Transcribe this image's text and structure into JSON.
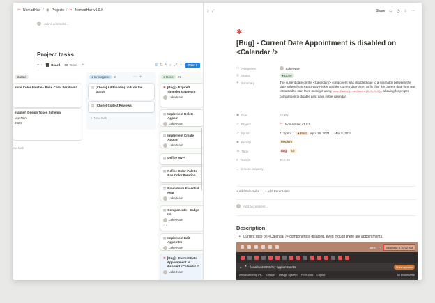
{
  "breadcrumb": {
    "workspace": "NomadHair",
    "projects": "Projects",
    "page": "NomadHair v1.0.0"
  },
  "left": {
    "comment_placeholder": "Add a comment...",
    "title": "Project tasks",
    "views": [
      "Board",
      "Tasks"
    ],
    "new_label": "New"
  },
  "columns": [
    {
      "label": "started",
      "count": "",
      "cards": [
        {
          "title": "efine Color Palette - Base Color Iteration II",
          "user": "",
          "meta": ""
        },
        {
          "title": "stablish Design Token Schema",
          "user": "uke Nam",
          "meta": "2024"
        }
      ],
      "new_task": "ew task"
    },
    {
      "label": "In progress",
      "count": "2",
      "cards": [
        {
          "title": "[Chore] Add loading indi on the button",
          "user": "",
          "meta": ""
        },
        {
          "title": "[Chore] Collect Reviews",
          "user": "",
          "meta": ""
        }
      ],
      "new_task": "New task"
    },
    {
      "label": "Done",
      "count": "21",
      "cards": [
        {
          "title": "[Bug] - Expired Timeslot s appears",
          "user": "Luke Nam",
          "meta": ""
        },
        {
          "title": "Implement Delete Appoin",
          "user": "Luke Nam",
          "meta": ""
        },
        {
          "title": "Implement Create Appoin",
          "user": "Luke Nam",
          "meta": ""
        },
        {
          "title": "Define MVP",
          "user": "",
          "meta": ""
        },
        {
          "title": "Refine Color Palette - Bas Color Iteration I",
          "user": "",
          "meta": ""
        },
        {
          "title": "Brainstorm Essential Feat",
          "user": "Luke Nam",
          "meta": ""
        },
        {
          "title": "Components - Badge UI",
          "user": "Luke Nam",
          "meta": "1"
        },
        {
          "title": "Implement Edit Appointm",
          "user": "Luke Nam",
          "meta": ""
        },
        {
          "title": "[Bug] - Current Date Appointment is disabled <Calendar />",
          "user": "Luke Nam",
          "meta": ""
        }
      ]
    }
  ],
  "right": {
    "share": "Share",
    "title": "[Bug] - Current Date Appointment is disabled on <Calendar />",
    "props": {
      "assignees_label": "Assignees",
      "assignees": "Luke Nam",
      "status_label": "Status",
      "status": "Done",
      "summary_label": "Summary",
      "summary_1": "The current date on the <Calendar /> component was disabled due to a mismatch between the date values from React-Day-Picker and the current date time. To fix this, the current date time was formatted to start from midnight using",
      "summary_code1": "new",
      "summary_code2": "Date().setHours(0,0,0,0)",
      "summary_2": ", allowing for proper comparison to disable past days in the calendar.",
      "due_label": "Due",
      "due": "Empty",
      "project_label": "Project",
      "project": "NomadHair v1.0.0",
      "sprint_label": "Sprint",
      "sprint": "Sprint 1",
      "sprint_badge": "Past",
      "sprint_dates": "April 29, 2024 → May 5, 2024",
      "priority_label": "Priority",
      "priority": "Medium",
      "tags_label": "Tags",
      "tag1": "Bug",
      "tag2": "UI",
      "taskid_label": "Task ID",
      "taskid": "TAS-89",
      "more": "1 more property"
    },
    "add_subtasks": "Add Sub-tasks",
    "add_parent": "Add Parent-task",
    "comment_placeholder": "Add a comment...",
    "desc_heading": "Description",
    "desc_bullet": "Current date on <Calendar /> component is disabled, even though there are appointments.",
    "screenshot": {
      "battery": "80%",
      "clock": "Mon May 6  10:32 AM",
      "url": "localhost:3000/my-appointments",
      "finish_update": "Finish update",
      "bookmarks": [
        "ARA Authoring Pr...",
        "Design",
        "Design System",
        "Front-End",
        "Layout"
      ],
      "all_bookmarks": "All Bookmarks"
    }
  },
  "colors": {
    "accent": "#2383e2",
    "bug": "#d44c47",
    "done": "#dbeddb"
  }
}
